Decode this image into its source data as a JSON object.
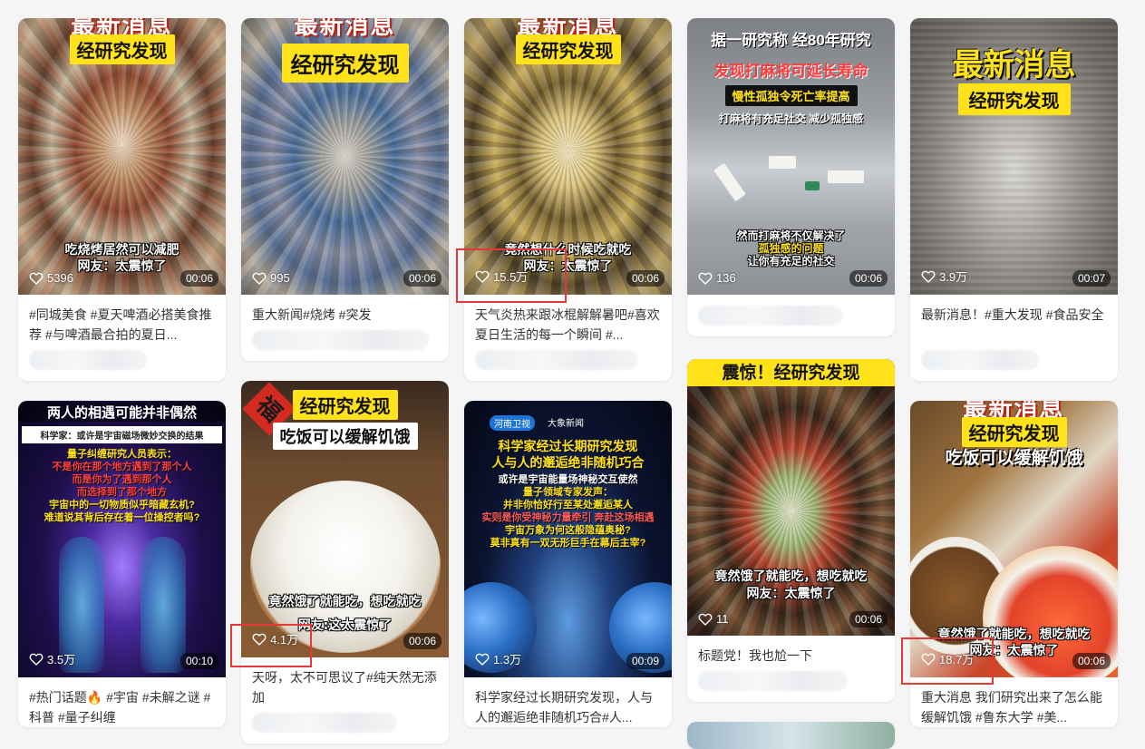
{
  "cards": [
    {
      "banner1": "最新消息",
      "banner2": "经研究发现",
      "caption1": "吃烧烤居然可以减肥",
      "caption2": "网友：太震惊了",
      "likes": "5396",
      "duration": "00:06",
      "desc": "#同城美食 #夏天啤酒必搭美食推荐 #与啤酒最合拍的夏日..."
    },
    {
      "banner1": "最新消息",
      "banner2": "经研究发现",
      "likes": "995",
      "duration": "00:06",
      "desc": "重大新闻#烧烤 #突发"
    },
    {
      "banner1": "最新消息",
      "banner2": "经研究发现",
      "caption1": "竟然想什么时候吃就吃",
      "caption2": "网友：太震惊了",
      "likes": "15.5万",
      "duration": "00:06",
      "desc": "天气炎热来跟冰棍解解暑吧#喜欢夏日生活的每一个瞬间 #..."
    },
    {
      "line1": "据一研究称 经80年研究",
      "line2": "发现打麻将可延长寿命",
      "line3": "慢性孤独令死亡率提高",
      "line4": "打麻将有充足社交 减少孤独感",
      "caption1": "然而打麻将不仅解决了",
      "caption2": "孤独感的问题",
      "caption3": "让你有充足的社交",
      "likes": "136",
      "duration": "00:06"
    },
    {
      "banner1": "最新消息",
      "banner2": "经研究发现",
      "likes": "3.9万",
      "duration": "00:07",
      "desc": "最新消息！#重大发现 #食品安全"
    },
    {
      "title": "两人的相遇可能并非偶然",
      "sub": "科学家：或许是宇宙磁场微妙交换的结果",
      "text1": "量子纠缠研究人员表示：",
      "text2": "不是你在那个地方遇到了那个人",
      "text3": "而是你为了遇到那个人",
      "text4": "而选择到了那个地方",
      "text5": "宇宙中的一切物质似乎暗藏玄机?",
      "text6": "难道说其背后存在着一位操控者吗?",
      "likes": "3.5万",
      "duration": "00:10",
      "desc": "#热门话题🔥 #宇宙 #未解之谜 #科普 #量子纠缠"
    },
    {
      "badge": "福",
      "banner1": "经研究发现",
      "banner2": "吃饭可以缓解饥饿",
      "caption1": "竟然饿了就能吃，想吃就吃",
      "caption2": "网友:这太震惊了",
      "likes": "4.1万",
      "duration": "00:06",
      "desc": "天呀，太不可思议了#纯天然无添加"
    },
    {
      "logo1": "河南卫视",
      "logo2": "大象新闻",
      "title1": "科学家经过长期研究发现",
      "title2": "人与人的邂逅绝非随机巧合",
      "text1": "或许是宇宙能量场神秘交互使然",
      "text2": "量子领域专家发声：",
      "text3": "并非你恰好行至某处邂逅某人",
      "text4": "实则是你受神秘力量牵引 奔赴这场相遇",
      "text5": "宇宙万象为何这般隐蕴奥秘?",
      "text6": "莫非真有一双无形巨手在幕后主宰?",
      "likes": "1.3万",
      "duration": "00:09",
      "desc": "科学家经过长期研究发现，人与人的邂逅绝非随机巧合#人..."
    },
    {
      "banner1": "震惊！经研究发现",
      "caption1": "竟然饿了就能吃，想吃就吃",
      "caption2": "网友：太震惊了",
      "likes": "11",
      "duration": "00:06",
      "desc": "标题党！我也尬一下"
    },
    {
      "banner1": "最新消息",
      "banner2": "经研究发现",
      "banner3": "吃饭可以缓解饥饿",
      "caption1": "竟然饿了就能吃，想吃就吃",
      "caption2": "网友：太震惊了",
      "likes": "18.7万",
      "duration": "00:06",
      "desc": "重大消息 我们研究出来了怎么能缓解饥饿 #鲁东大学 #美..."
    }
  ]
}
